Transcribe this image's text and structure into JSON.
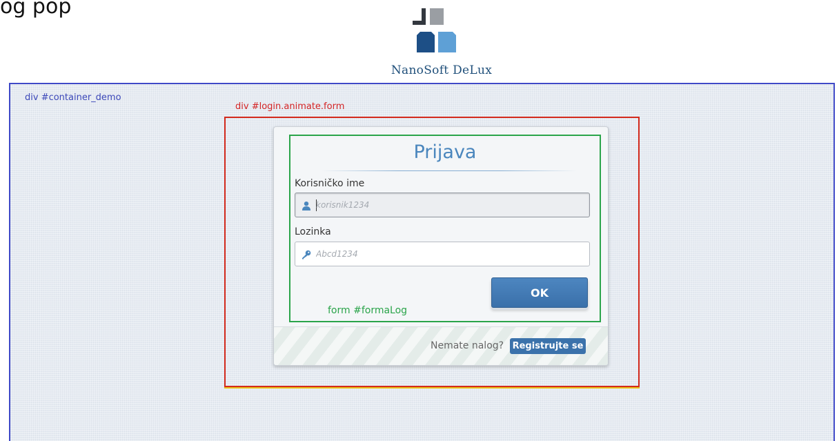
{
  "page": {
    "top_text": "og pop"
  },
  "logo": {
    "text": "NanoSoft DeLux",
    "colors": {
      "dark_gray": "#33383f",
      "light_gray": "#9a9ea3",
      "dark_blue": "#1d4f86",
      "light_blue": "#5ea0d6"
    }
  },
  "annotations": {
    "container_label": "div #container_demo",
    "login_label": "div #login.animate.form",
    "form_label": "form #formaLog",
    "colors": {
      "container": "#3f49c7",
      "login": "#d42a1c",
      "form": "#2aa44a"
    }
  },
  "login_form": {
    "title": "Prijava",
    "username": {
      "label": "Korisničko ime",
      "placeholder": "korisnik1234",
      "icon": "user-icon"
    },
    "password": {
      "label": "Lozinka",
      "placeholder": "Abcd1234",
      "icon": "key-icon"
    },
    "submit_label": "OK"
  },
  "footer": {
    "question": "Nemate nalog?",
    "register_label": "Registrujte se"
  }
}
